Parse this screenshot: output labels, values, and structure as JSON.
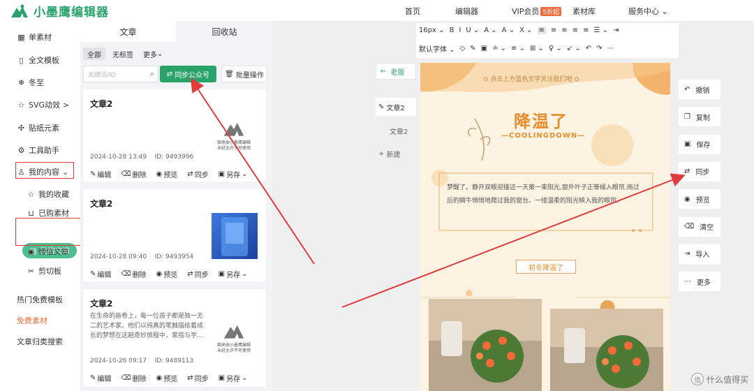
{
  "app": {
    "name": "小墨鹰编辑器"
  },
  "topnav": {
    "home": "首页",
    "editor": "编辑器",
    "vip": "VIP会员",
    "vip_badge": "5折起",
    "assets": "素材库",
    "service": "服务中心"
  },
  "sidebar": {
    "items": [
      {
        "label": "单素材",
        "icon": "grid-icon"
      },
      {
        "label": "全文模板",
        "icon": "doc-icon"
      },
      {
        "label": "冬至",
        "icon": "snow-icon"
      },
      {
        "label": "SVG动效",
        "icon": "star-icon",
        "suffix": ">"
      },
      {
        "label": "贴纸元素",
        "icon": "puzzle-icon"
      },
      {
        "label": "工具助手",
        "icon": "tool-icon"
      },
      {
        "label": "我的内容",
        "icon": "user-icon",
        "suffix": "⌄"
      }
    ],
    "sub_items": [
      {
        "label": "我的收藏",
        "icon": "star-outline-icon"
      },
      {
        "label": "已购素材",
        "icon": "cart-icon"
      },
      {
        "label": "我的文章",
        "icon": "doc-icon",
        "active": true
      },
      {
        "label": "微信文章",
        "icon": "wechat-icon"
      },
      {
        "label": "剪切板",
        "icon": "scissors-icon"
      }
    ],
    "bottom": [
      {
        "label": "热门免费模板"
      },
      {
        "label": "免费素材",
        "color": "#f26b3a"
      },
      {
        "label": "文章归类搜索"
      }
    ]
  },
  "panel": {
    "tab_active": "文章",
    "tab_inactive": "回收站",
    "filters": [
      "全部",
      "无标签",
      "更多"
    ],
    "search_placeholder": "关键词/ID",
    "sync_button": "同步公众号",
    "batch_button": "批量操作",
    "cards": [
      {
        "title": "文章2",
        "body": "",
        "date": "2024-10-28 13:49",
        "id": "ID: 9493996",
        "thumb": "watermark",
        "wm_line1": "图来由小墨鹰编辑",
        "wm_line2": "未经允许不可使用"
      },
      {
        "title": "文章2",
        "body": "",
        "date": "2024-10-28 09:40",
        "id": "ID: 9493954",
        "thumb": "blue"
      },
      {
        "title": "文章2",
        "body": "在生命的画卷上，每一位孩子都是独一无二的艺术家。他们以纯真的笔触描绘着成长的梦想在这趟奇妙旅程中，家指与学...",
        "date": "2024-10-26 09:17",
        "id": "ID: 9489113",
        "thumb": "watermark",
        "wm_line1": "图来由小墨鹰编辑",
        "wm_line2": "未经允许不可使用"
      }
    ],
    "actions": [
      "编辑",
      "删除",
      "预览",
      "同步",
      "另存"
    ]
  },
  "editor": {
    "back": "老版",
    "articles": [
      "文章2",
      "文章2"
    ],
    "new_label": "新建",
    "toolbar_row1": [
      "16px ⌄",
      "B",
      "I",
      "U ⌄",
      "A ⌄",
      "A ⌄",
      "X ⌄",
      "≡",
      "≡",
      "≡",
      "≡",
      "≡",
      "☰ ⌄",
      "⇥"
    ],
    "toolbar_row2": [
      "默认字体 ⌄",
      "◇",
      "✎",
      "▣",
      "≐ ⌄",
      "≡ ⌄",
      "⊞ ⌄",
      "♀ ⌄",
      "↙ ⌄",
      "↶",
      "↷",
      "⋯"
    ],
    "canvas": {
      "top_text": "点击上方蓝色文字关注我们吧",
      "headline": "降温了",
      "subhead": "COOLINGDOWN",
      "paragraph": "梦醒了。静开双眼迎接这一天第一束阳光,窗外叶子正等候入眼帘,雨过后的鳞牛悄悄地爬过我的窗台。一缕温柔的阳光映入我的眼帘。",
      "tag": "初冬降温了"
    },
    "side_actions": [
      {
        "label": "撤销",
        "icon": "undo-icon"
      },
      {
        "label": "复制",
        "icon": "copy-icon"
      },
      {
        "label": "保存",
        "icon": "save-icon"
      },
      {
        "label": "同步",
        "icon": "sync-icon"
      },
      {
        "label": "预览",
        "icon": "eye-icon"
      },
      {
        "label": "清空",
        "icon": "trash-icon"
      },
      {
        "label": "导入",
        "icon": "import-icon"
      },
      {
        "label": "更多",
        "icon": "more-icon"
      }
    ]
  },
  "watermark_site": "什么值得买",
  "colors": {
    "brand": "#2aa36b",
    "arrow": "#e23b3b",
    "orange": "#e98b2a"
  }
}
